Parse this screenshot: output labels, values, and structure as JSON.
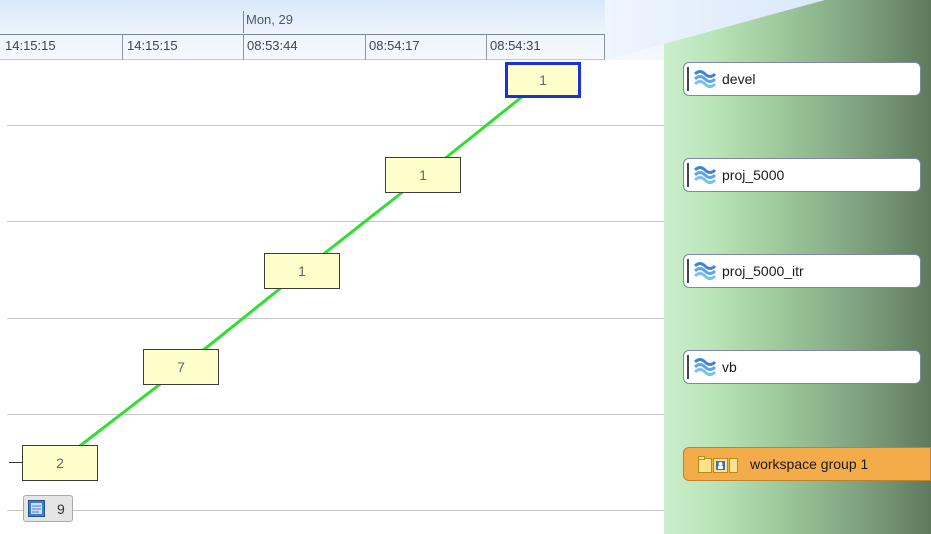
{
  "timeline": {
    "day_label": "Mon, 29",
    "times": [
      "14:15:15",
      "14:15:15",
      "08:53:44",
      "08:54:17",
      "08:54:31"
    ]
  },
  "streams": [
    {
      "name": "devel",
      "icon": "stream-icon"
    },
    {
      "name": "proj_5000",
      "icon": "stream-icon"
    },
    {
      "name": "proj_5000_itr",
      "icon": "stream-icon"
    },
    {
      "name": "vb",
      "icon": "stream-icon"
    }
  ],
  "workspace_group": {
    "name": "workspace group 1",
    "icon": "workspace-group-icon"
  },
  "transactions": [
    {
      "count": "1",
      "selected": true
    },
    {
      "count": "1",
      "selected": false
    },
    {
      "count": "1",
      "selected": false
    },
    {
      "count": "7",
      "selected": false
    },
    {
      "count": "2",
      "selected": false
    }
  ],
  "overflow_badge": {
    "count": "9",
    "icon": "document-icon"
  },
  "colors": {
    "connector": "#33dd33",
    "selected_border": "#1d2fd6",
    "transaction_fill": "#ffffcc",
    "group_fill": "#f4ab4a"
  }
}
